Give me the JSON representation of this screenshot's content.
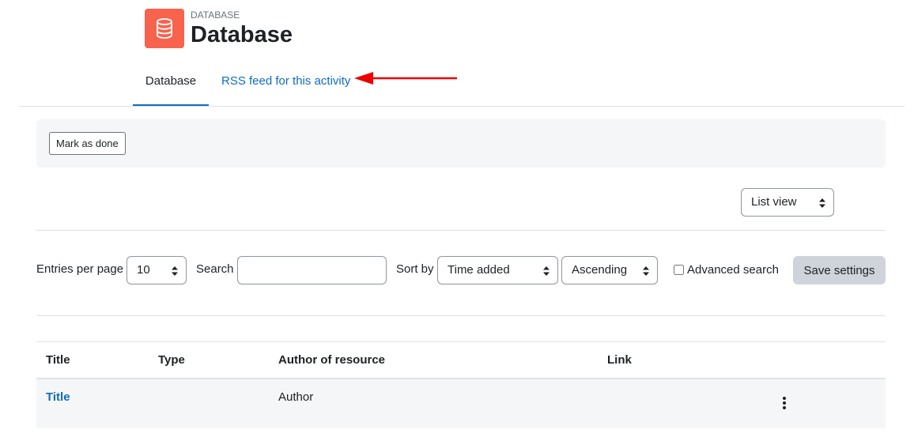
{
  "activity": {
    "type_label": "DATABASE",
    "title": "Database",
    "icon": "database-icon",
    "icon_color": "#f7634d"
  },
  "tabs": [
    {
      "label": "Database",
      "active": true
    },
    {
      "label": "RSS feed for this activity",
      "active": false
    }
  ],
  "annotation": {
    "arrow_color": "#ee0000"
  },
  "completion": {
    "mark_done_label": "Mark as done"
  },
  "view_select": {
    "selected": "List view"
  },
  "filters": {
    "entries_per_page_label": "Entries per page",
    "entries_per_page_value": "10",
    "search_label": "Search",
    "search_value": "",
    "sort_by_label": "Sort by",
    "sort_by_value": "Time added",
    "order_value": "Ascending",
    "advanced_search_label": "Advanced search",
    "advanced_search_checked": false,
    "save_label": "Save settings"
  },
  "table": {
    "headers": [
      "Title",
      "Type",
      "Author of resource",
      "Link"
    ],
    "rows": [
      {
        "title": "Title",
        "type": "",
        "author": "Author",
        "link": "",
        "actions_icon": "kebab-menu-icon"
      }
    ]
  },
  "colors": {
    "link": "#0f6cbf",
    "accent": "#0f6cbf"
  }
}
